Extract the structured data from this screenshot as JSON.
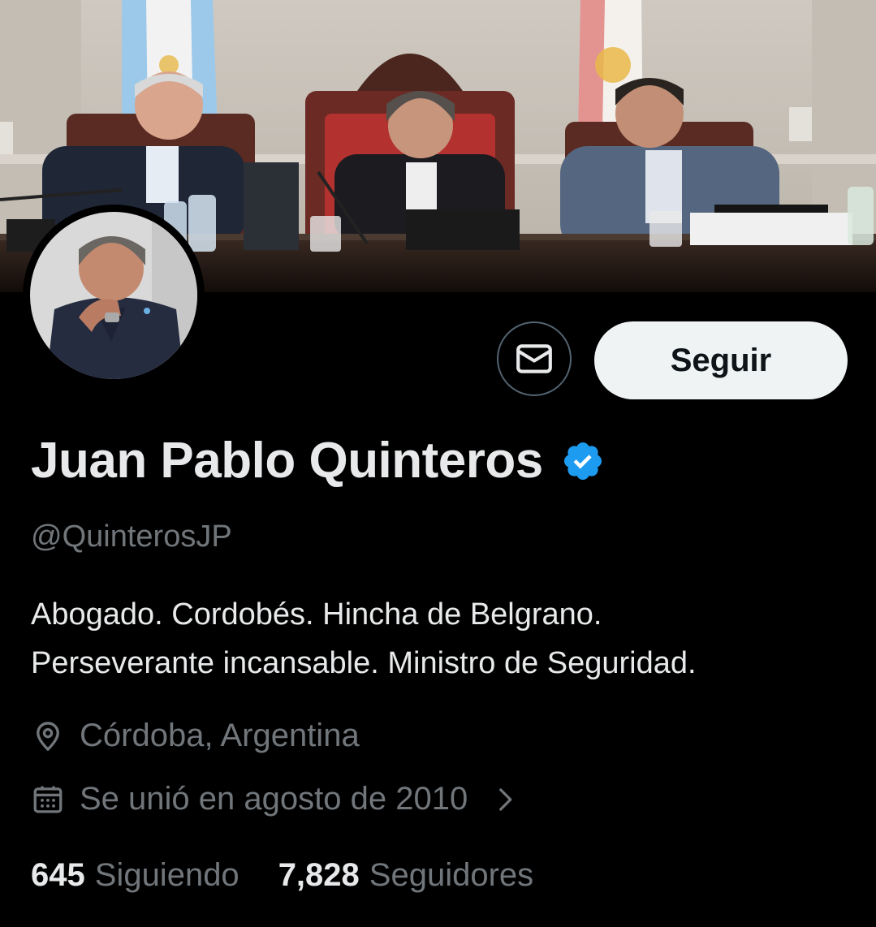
{
  "profile": {
    "display_name": "Juan Pablo Quinteros",
    "handle": "@QuinterosJP",
    "verified": true,
    "bio_lines": [
      "Abogado. Cordobés. Hincha de Belgrano.",
      "Perseverante incansable. Ministro de Seguridad."
    ],
    "location": "Córdoba, Argentina",
    "joined": "Se unió en agosto de 2010"
  },
  "actions": {
    "follow_label": "Seguir",
    "message_icon": "envelope-icon"
  },
  "stats": {
    "following_count": "645",
    "following_label": "Siguiendo",
    "followers_count": "7,828",
    "followers_label": "Seguidores"
  },
  "icons": {
    "verified": "verified-badge-icon",
    "location": "location-pin-icon",
    "joined": "calendar-icon",
    "chevron": "chevron-right-icon"
  },
  "colors": {
    "background": "#000000",
    "primary_text": "#e7e9ea",
    "secondary_text": "#71767b",
    "verified_blue": "#1d9bf0",
    "follow_button_bg": "#eff3f4",
    "outline": "#536471"
  }
}
